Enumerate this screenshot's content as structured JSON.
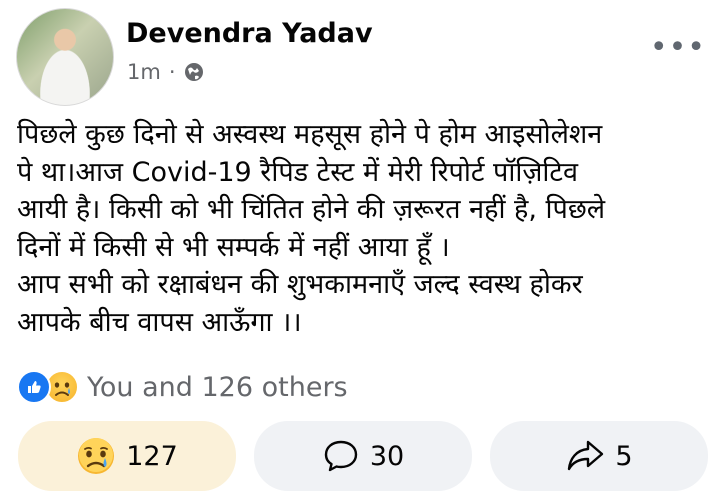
{
  "post": {
    "author": "Devendra Yadav",
    "time": "1m",
    "separator": "·",
    "audience_icon": "globe-icon",
    "lines": [
      "पिछले कुछ दिनो से अस्वस्थ महसूस होने पे होम आइसोलेशन",
      "पे था।आज Covid-19 रैपिड टेस्ट में मेरी रिपोर्ट पॉज़िटिव",
      "आयी है। किसी को भी चिंतित होने की ज़रूरत नहीं है, पिछले",
      "दिनों में किसी से भी सम्पर्क में नहीं आया हूँ ।",
      "आप सभी को रक्षाबंधन की शुभकामनाएँ जल्द स्वस्थ होकर",
      "आपके बीच वापस आऊँगा ।।"
    ]
  },
  "reactions": {
    "icons": [
      "like-icon",
      "sad-icon"
    ],
    "summary": "You and 126 others"
  },
  "actions": {
    "react_count": "127",
    "comment_count": "30",
    "share_count": "5"
  },
  "colors": {
    "like_blue": "#1877f2",
    "secondary_text": "#65676b",
    "button_bg": "#f0f2f5",
    "active_button_bg": "#fbf1d9"
  }
}
